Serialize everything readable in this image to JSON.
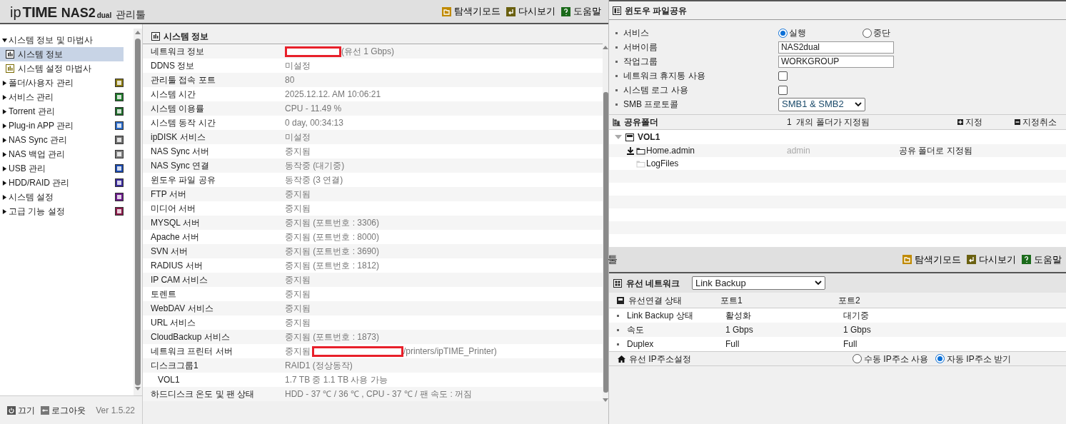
{
  "header": {
    "logo_prefix": "ip",
    "logo_brand": "TIME",
    "logo_model": "NAS2",
    "logo_model_suffix": "dual",
    "logo_suffix": "관리툴"
  },
  "toolbar": [
    {
      "label": "탐색기모드",
      "kind": "explorer"
    },
    {
      "label": "다시보기",
      "kind": "refresh"
    },
    {
      "label": "도움말",
      "kind": "help"
    }
  ],
  "sidebar": {
    "items": [
      {
        "label": "시스템 정보 및 마법사",
        "expanded": true,
        "children": [
          {
            "label": "시스템 정보",
            "selected": true
          },
          {
            "label": "시스템 설정 마법사",
            "selected": false
          }
        ]
      },
      {
        "label": "폴더/사용자 관리",
        "expanded": false,
        "color": "#8a7a10"
      },
      {
        "label": "서비스 관리",
        "expanded": false,
        "color": "#1e7a2a"
      },
      {
        "label": "Torrent 관리",
        "expanded": false,
        "color": "#1e6a2a"
      },
      {
        "label": "Plug-in APP 관리",
        "expanded": false,
        "color": "#2a6ac8"
      },
      {
        "label": "NAS Sync 관리",
        "expanded": false,
        "color": "#707070"
      },
      {
        "label": "NAS 백업 관리",
        "expanded": false,
        "color": "#808080"
      },
      {
        "label": "USB 관리",
        "expanded": false,
        "color": "#1a4ab0"
      },
      {
        "label": "HDD/RAID 관리",
        "expanded": false,
        "color": "#3a2a9a"
      },
      {
        "label": "시스템 설정",
        "expanded": false,
        "color": "#6a1a8a"
      },
      {
        "label": "고급 기능 설정",
        "expanded": false,
        "color": "#8a1a4a"
      }
    ],
    "footer": {
      "power": "끄기",
      "logout": "로그아웃",
      "version": "Ver 1.5.22"
    }
  },
  "system_info": {
    "title": "시스템 정보",
    "rows": [
      {
        "label": "네트워크 정보",
        "redacted": true,
        "value": "(유선 1 Gbps)"
      },
      {
        "label": "DDNS 정보",
        "value": "미설정"
      },
      {
        "label": "관리툴 접속 포트",
        "value": "80"
      },
      {
        "label": "시스템 시간",
        "value": "2025.12.12. AM 10:06:21"
      },
      {
        "label": "시스템 이용률",
        "value": "CPU - 11.49 %"
      },
      {
        "label": "시스템 동작 시간",
        "value": "0 day, 00:34:13"
      },
      {
        "label": "ipDISK 서비스",
        "value": "미설정"
      },
      {
        "label": "NAS Sync 서버",
        "value": "중지됨"
      },
      {
        "label": "NAS Sync 연결",
        "value": "동작중 (대기중)"
      },
      {
        "label": "윈도우 파일 공유",
        "value": "동작중 (3 연결)"
      },
      {
        "label": "FTP 서버",
        "value": "중지됨"
      },
      {
        "label": "미디어 서버",
        "value": "중지됨"
      },
      {
        "label": "MYSQL 서버",
        "value": "중지됨 (포트번호 : 3306)"
      },
      {
        "label": "Apache 서버",
        "value": "중지됨 (포트번호 : 8000)"
      },
      {
        "label": "SVN 서버",
        "value": "중지됨 (포트번호 : 3690)"
      },
      {
        "label": "RADIUS 서버",
        "value": "중지됨 (포트번호 : 1812)"
      },
      {
        "label": "IP CAM 서비스",
        "value": "중지됨"
      },
      {
        "label": "토렌트",
        "value": "중지됨"
      },
      {
        "label": "WebDAV 서비스",
        "value": "중지됨"
      },
      {
        "label": "URL 서비스",
        "value": "중지됨"
      },
      {
        "label": "CloudBackup 서비스",
        "value": "중지됨 (포트번호 : 1873)"
      },
      {
        "label": "네트워크 프린터 서버",
        "value_prefix": "중지됨",
        "redacted": true,
        "value": "/printers/ipTIME_Printer)"
      },
      {
        "label": "디스크그룹1",
        "value": "RAID1 (정상동작)",
        "children": [
          {
            "label": "VOL1",
            "value": "1.7 TB 중 1.1 TB 사용 가능"
          }
        ]
      },
      {
        "label": "하드디스크 온도 및 팬 상태",
        "value": "HDD - 37 ℃ / 36 ℃ , CPU - 37 ℃ / 팬 속도 : 꺼짐"
      }
    ]
  },
  "file_sharing": {
    "title": "윈도우 파일공유",
    "settings": [
      {
        "label": "서비스",
        "kind": "radio",
        "options": [
          {
            "label": "실행",
            "selected": true
          },
          {
            "label": "중단",
            "selected": false
          }
        ]
      },
      {
        "label": "서버이름",
        "kind": "text",
        "value": "NAS2dual"
      },
      {
        "label": "작업그룹",
        "kind": "text",
        "value": "WORKGROUP"
      },
      {
        "label": "네트워크 휴지통 사용",
        "kind": "checkbox",
        "checked": false
      },
      {
        "label": "시스템 로그 사용",
        "kind": "checkbox",
        "checked": false
      },
      {
        "label": "SMB 프로토콜",
        "kind": "select",
        "value": "SMB1 & SMB2"
      }
    ],
    "shared_folders": {
      "title": "공유폴더",
      "count": "1  개의 폴더가 지정됨",
      "add": "지정",
      "remove": "지정취소",
      "tree": [
        {
          "label": "VOL1",
          "expanded": true,
          "children": [
            {
              "label": "Home.admin",
              "shared": true,
              "owner": "admin",
              "status": "공유 폴더로 지정됨"
            },
            {
              "label": "LogFiles",
              "shared": false
            }
          ]
        }
      ]
    }
  },
  "network_panel": {
    "header_title": "툴",
    "toolbar": [
      {
        "label": "탐색기모드",
        "kind": "explorer"
      },
      {
        "label": "다시보기",
        "kind": "refresh"
      },
      {
        "label": "도움말",
        "kind": "help"
      }
    ],
    "title": "유선 네트워크",
    "mode": "Link Backup",
    "columns": [
      "유선연결 상태",
      "포트1",
      "포트2"
    ],
    "rows": [
      [
        "Link Backup 상태",
        "활성화",
        "대기중"
      ],
      [
        "속도",
        "1 Gbps",
        "1 Gbps"
      ],
      [
        "Duplex",
        "Full",
        "Full"
      ]
    ],
    "ip_setting": {
      "label": "유선 IP주소설정",
      "options": [
        {
          "label": "수동 IP주소 사용",
          "selected": false
        },
        {
          "label": "자동 IP주소 받기",
          "selected": true
        }
      ]
    }
  }
}
